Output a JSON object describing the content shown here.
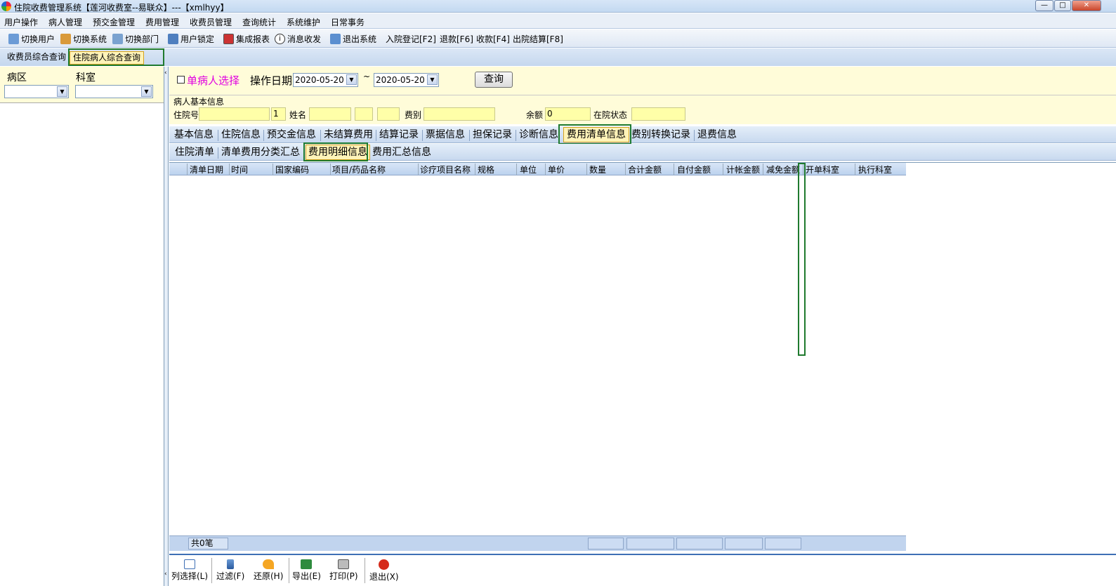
{
  "window": {
    "title": "住院收费管理系统【莲河收费室--易联众】---【xmlhyy】"
  },
  "menu": [
    "用户操作",
    "病人管理",
    "预交金管理",
    "费用管理",
    "收费员管理",
    "查询统计",
    "系统维护",
    "日常事务"
  ],
  "toolbar": [
    "切换用户",
    "切换系统",
    "切换部门",
    "用户锁定",
    "集成报表",
    "消息收发",
    "退出系统",
    "入院登记[F2]",
    "退款[F6]",
    "收款[F4]",
    "出院结算[F8]"
  ],
  "top_tabs": [
    "收费员综合查询",
    "住院病人综合查询"
  ],
  "left": {
    "ward_label": "病区",
    "dept_label": "科室"
  },
  "filter": {
    "single_patient": "单病人选择",
    "date_label": "操作日期",
    "date_from": "2020-05-20",
    "tilde": "~",
    "date_to": "2020-05-20",
    "query_button": "查询"
  },
  "patient_info": {
    "section_title": "病人基本信息",
    "inpatient_no_label": "住院号",
    "inpatient_seq": "1",
    "name_label": "姓名",
    "fee_type_label": "费别",
    "balance_label": "余额",
    "balance_value": "0",
    "status_label": "在院状态"
  },
  "info_tabs": [
    "基本信息",
    "住院信息",
    "预交金信息",
    "未结算费用",
    "结算记录",
    "票据信息",
    "担保记录",
    "诊断信息",
    "费用清单信息",
    "费别转换记录",
    "退费信息"
  ],
  "sub_tabs": [
    "住院清单",
    "清单费用分类汇总",
    "费用明细信息",
    "费用汇总信息"
  ],
  "grid": {
    "columns": [
      "清单日期",
      "时间",
      "国家编码",
      "项目/药品名称",
      "诊疗项目名称",
      "规格",
      "单位",
      "单价",
      "数量",
      "合计金额",
      "自付金额",
      "计帐金额",
      "减免金额",
      "开单科室",
      "执行科室"
    ],
    "footer_count": "共0笔"
  },
  "bottom_buttons": [
    "列选择(L)",
    "过滤(F)",
    "还原(H)",
    "导出(E)",
    "打印(P)",
    "退出(X)"
  ],
  "colors": {
    "accent": "#3e6fb5",
    "highlight": "#1f7a2e",
    "yellow_field": "#ffffa8",
    "panel_bg": "#fffcd9",
    "magenta_text": "#e000e0"
  }
}
